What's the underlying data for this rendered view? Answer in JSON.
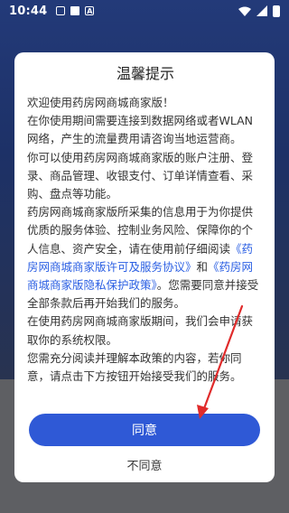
{
  "status_bar": {
    "time": "10:44",
    "notif_icons": [
      "gallery-icon",
      "image-icon",
      "a-icon"
    ],
    "right_icons": [
      "wifi-icon",
      "signal-icon",
      "battery-icon"
    ]
  },
  "dialog": {
    "title": "温馨提示",
    "p1": "欢迎使用药房网商城商家版！",
    "p2": "在你使用期间需要连接到数据网络或者WLAN网络，产生的流量费用请咨询当地运营商。",
    "p3": "你可以使用药房网商城商家版的账户注册、登录、商品管理、收银支付、订单详情查看、采购、盘点等功能。",
    "p4_a": "药房网商城商家版所采集的信息用于为你提供优质的服务体验、控制业务风险、保障你的个人信息、资产安全，请在使用前仔细阅读",
    "p4_link1": "《药房网商城商家版许可及服务协议》",
    "p4_b": "和",
    "p4_link2": "《药房网商城商家版隐私保护政策》",
    "p4_c": "。您需要同意并接受全部条款后再开始我们的服务。",
    "p5": "在使用药房网商城商家版期间，我们会申请获取你的系统权限。",
    "p6": "您需充分阅读并理解本政策的内容，若你同意，请点击下方按钮开始接受我们的服务。",
    "agree_label": "同意",
    "disagree_label": "不同意"
  },
  "colors": {
    "accent": "#2f59d6",
    "link": "#2b5fe3",
    "annotation_arrow": "#e02b2b"
  }
}
